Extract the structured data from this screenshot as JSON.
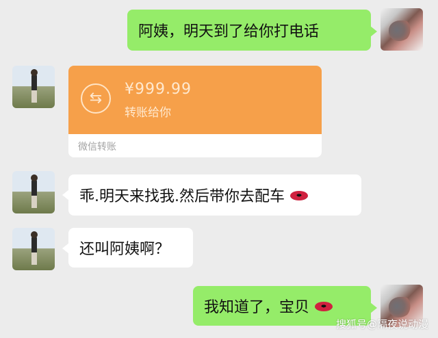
{
  "messages": {
    "m1": "阿姨，明天到了给你打电话",
    "m2": "乖.明天来找我.然后带你去配车",
    "m3": "还叫阿姨啊？",
    "m4": "我知道了，宝贝"
  },
  "transfer": {
    "amount": "¥999.99",
    "label": "转账给你",
    "source": "微信转账",
    "icon_name": "transfer-arrows-icon"
  },
  "emoji": {
    "lips": "lips-emoji"
  },
  "watermark": "搜狐号@隔夜说动漫",
  "colors": {
    "background": "#ececec",
    "my_bubble": "#95ec69",
    "their_bubble": "#ffffff",
    "transfer_orange": "#f6a04a"
  }
}
